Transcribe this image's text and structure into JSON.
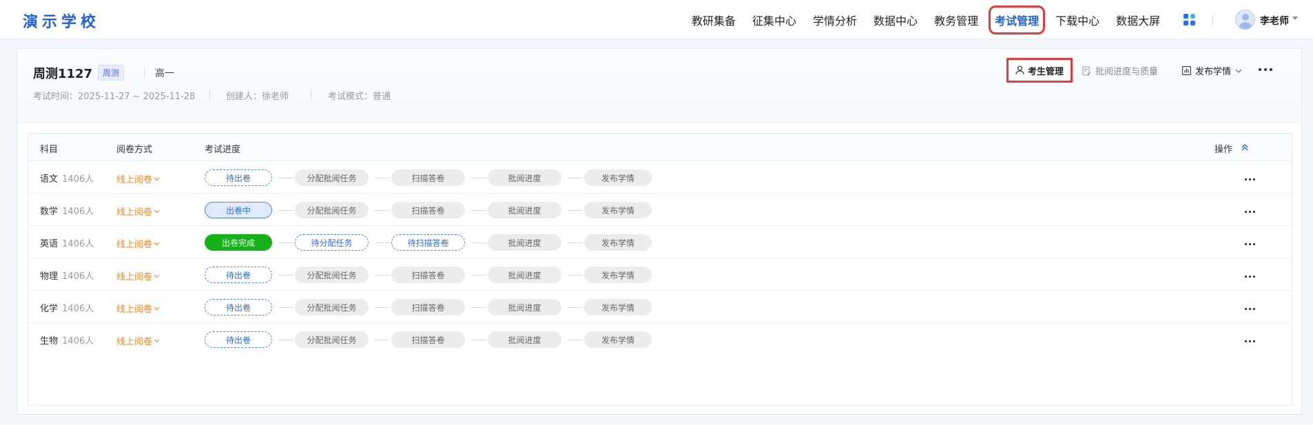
{
  "header": {
    "logo": "演示学校",
    "nav": [
      {
        "label": "教研集备",
        "active": false
      },
      {
        "label": "征集中心",
        "active": false
      },
      {
        "label": "学情分析",
        "active": false
      },
      {
        "label": "数据中心",
        "active": false
      },
      {
        "label": "教务管理",
        "active": false
      },
      {
        "label": "考试管理",
        "active": true
      },
      {
        "label": "下载中心",
        "active": false
      },
      {
        "label": "数据大屏",
        "active": false
      }
    ],
    "apps_icon": "grid-apps-icon",
    "user": {
      "name": "李老师",
      "avatar_icon": "user-avatar-icon"
    }
  },
  "exam": {
    "title": "周测1127",
    "type_tag": "周测",
    "grade": "高一",
    "time_label": "考试时间：2025-11-27 ~ 2025-11-28",
    "creator_label": "创建人：徐老师",
    "mode_label": "考试模式：普通",
    "actions": {
      "student_manage": "考生管理",
      "review_quality": "批阅进度与质量",
      "publish": "发布学情"
    }
  },
  "table": {
    "headers": {
      "subject": "科目",
      "mode": "阅卷方式",
      "progress": "考试进度",
      "ops": "操作"
    },
    "rows": [
      {
        "subject": "语文",
        "count": "1406人",
        "mode": "线上阅卷",
        "steps": [
          {
            "label": "待出卷",
            "state": "dashed"
          },
          {
            "label": "分配批阅任务",
            "state": "gray"
          },
          {
            "label": "扫描答卷",
            "state": "gray"
          },
          {
            "label": "批阅进度",
            "state": "gray"
          },
          {
            "label": "发布学情",
            "state": "gray"
          }
        ]
      },
      {
        "subject": "数学",
        "count": "1406人",
        "mode": "线上阅卷",
        "steps": [
          {
            "label": "出卷中",
            "state": "blue"
          },
          {
            "label": "分配批阅任务",
            "state": "gray"
          },
          {
            "label": "扫描答卷",
            "state": "gray"
          },
          {
            "label": "批阅进度",
            "state": "gray"
          },
          {
            "label": "发布学情",
            "state": "gray"
          }
        ]
      },
      {
        "subject": "英语",
        "count": "1406人",
        "mode": "线上阅卷",
        "steps": [
          {
            "label": "出卷完成",
            "state": "green"
          },
          {
            "label": "待分配任务",
            "state": "dashed"
          },
          {
            "label": "待扫描答卷",
            "state": "dashed"
          },
          {
            "label": "批阅进度",
            "state": "gray"
          },
          {
            "label": "发布学情",
            "state": "gray"
          }
        ]
      },
      {
        "subject": "物理",
        "count": "1406人",
        "mode": "线上阅卷",
        "steps": [
          {
            "label": "待出卷",
            "state": "dashed"
          },
          {
            "label": "分配批阅任务",
            "state": "gray"
          },
          {
            "label": "扫描答卷",
            "state": "gray"
          },
          {
            "label": "批阅进度",
            "state": "gray"
          },
          {
            "label": "发布学情",
            "state": "gray"
          }
        ]
      },
      {
        "subject": "化学",
        "count": "1406人",
        "mode": "线上阅卷",
        "steps": [
          {
            "label": "待出卷",
            "state": "dashed"
          },
          {
            "label": "分配批阅任务",
            "state": "gray"
          },
          {
            "label": "扫描答卷",
            "state": "gray"
          },
          {
            "label": "批阅进度",
            "state": "gray"
          },
          {
            "label": "发布学情",
            "state": "gray"
          }
        ]
      },
      {
        "subject": "生物",
        "count": "1406人",
        "mode": "线上阅卷",
        "steps": [
          {
            "label": "待出卷",
            "state": "dashed"
          },
          {
            "label": "分配批阅任务",
            "state": "gray"
          },
          {
            "label": "扫描答卷",
            "state": "gray"
          },
          {
            "label": "批阅进度",
            "state": "gray"
          },
          {
            "label": "发布学情",
            "state": "gray"
          }
        ]
      }
    ]
  },
  "colors": {
    "brand": "#1f5fe0",
    "highlight": "#e63a3a",
    "mode_orange": "#f08a2a",
    "done_green": "#16b21a"
  }
}
